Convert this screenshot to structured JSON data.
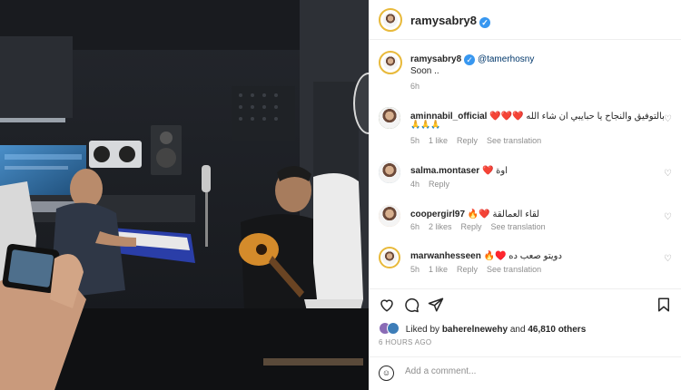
{
  "post": {
    "author": "ramysabry8",
    "verified_mark": "✓"
  },
  "caption": {
    "author": "ramysabry8",
    "mention": "@tamerhosny",
    "text": "Soon ..",
    "time": "6h"
  },
  "comments": [
    {
      "user": "aminnabil_official",
      "text": "بالتوفيق والنجاح يا حبايبي ان شاء الله",
      "hearts": "❤️❤️❤️",
      "extra": "🙏🙏🙏",
      "time": "5h",
      "likes": "1 like",
      "reply": "Reply",
      "translate": "See translation"
    },
    {
      "user": "salma.montaser",
      "text": "اوة",
      "hearts": "❤️",
      "time": "4h",
      "reply": "Reply"
    },
    {
      "user": "coopergirl97",
      "text": "لقاء العمالقة",
      "hearts": "🔥❤️",
      "time": "6h",
      "likes": "2 likes",
      "reply": "Reply",
      "translate": "See translation"
    },
    {
      "user": "marwanhesseen",
      "text": "دويتو صعب ده",
      "hearts": "🔥♥️",
      "time": "5h",
      "likes": "1 like",
      "reply": "Reply",
      "translate": "See translation"
    }
  ],
  "actions": {
    "icons": [
      "heart-icon",
      "comment-icon",
      "share-icon",
      "save-icon"
    ]
  },
  "likes": {
    "prefix": "Liked by",
    "user": "baherelnewehy",
    "and": "and",
    "count": "46,810 others"
  },
  "posted": "6 HOURS AGO",
  "add_comment": {
    "placeholder": "Add a comment..."
  },
  "colors": {
    "link": "#00376b",
    "verified": "#3897f0",
    "muted": "#8e8e8e",
    "story_ring": "#e8b93a"
  }
}
